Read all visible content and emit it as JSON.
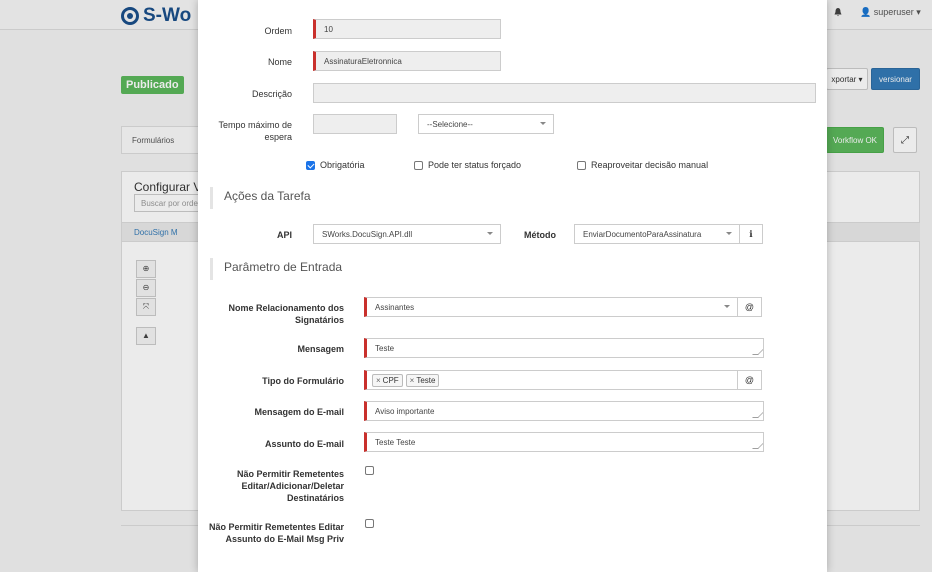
{
  "background": {
    "logo_text": "S-Wo",
    "user": "superuser",
    "status_badge": "Publicado",
    "exportar_label": "xportar",
    "versionar_label": "versionar",
    "tab_formularios": "Formulários",
    "workflow_ok_label": "Vorkflow OK",
    "panel_title": "Configurar V",
    "search_placeholder": "Buscar por orde",
    "row_link": "DocuSign M"
  },
  "form": {
    "ordem": {
      "label": "Ordem",
      "value": "10"
    },
    "nome": {
      "label": "Nome",
      "value": "AssinaturaEletronnica"
    },
    "descricao": {
      "label": "Descrição",
      "value": ""
    },
    "tempo": {
      "label": "Tempo máximo de espera",
      "value": "",
      "select_value": "--Selecione--"
    },
    "checks": [
      {
        "label": "Obrigatória",
        "checked": true
      },
      {
        "label": "Pode ter status forçado",
        "checked": false
      },
      {
        "label": "Reaproveitar decisão manual",
        "checked": false
      }
    ],
    "section_acoes": "Ações da Tarefa",
    "api": {
      "label": "API",
      "value": "SWorks.DocuSign.API.dll"
    },
    "metodo": {
      "label": "Método",
      "value": "EnviarDocumentoParaAssinatura"
    },
    "section_parametros": "Parâmetro de Entrada",
    "params": {
      "relacionamento": {
        "label": "Nome Relacionamento dos Signatários",
        "value": "Assinantes"
      },
      "mensagem": {
        "label": "Mensagem",
        "value": "Teste"
      },
      "tipo_formulario": {
        "label": "Tipo do Formulário",
        "tags": [
          "CPF",
          "Teste"
        ]
      },
      "mensagem_email": {
        "label": "Mensagem do E-mail",
        "value": "Aviso importante"
      },
      "assunto_email": {
        "label": "Assunto do E-mail",
        "value": "Teste Teste"
      },
      "nao_permitir_dest": {
        "label": "Não Permitir Remetentes Editar/Adicionar/Deletar Destinatários",
        "checked": false
      },
      "nao_permitir_assunto": {
        "label": "Não Permitir Remetentes Editar Assunto do E-Mail Msg Priv",
        "checked": false
      }
    },
    "at_symbol": "@",
    "info_symbol": "ℹ",
    "tag_remove_symbol": "×"
  },
  "colors": {
    "required": "#c9302c",
    "primary": "#337ab7",
    "success": "#5cb85c",
    "checkbox": "#1a73e8"
  }
}
